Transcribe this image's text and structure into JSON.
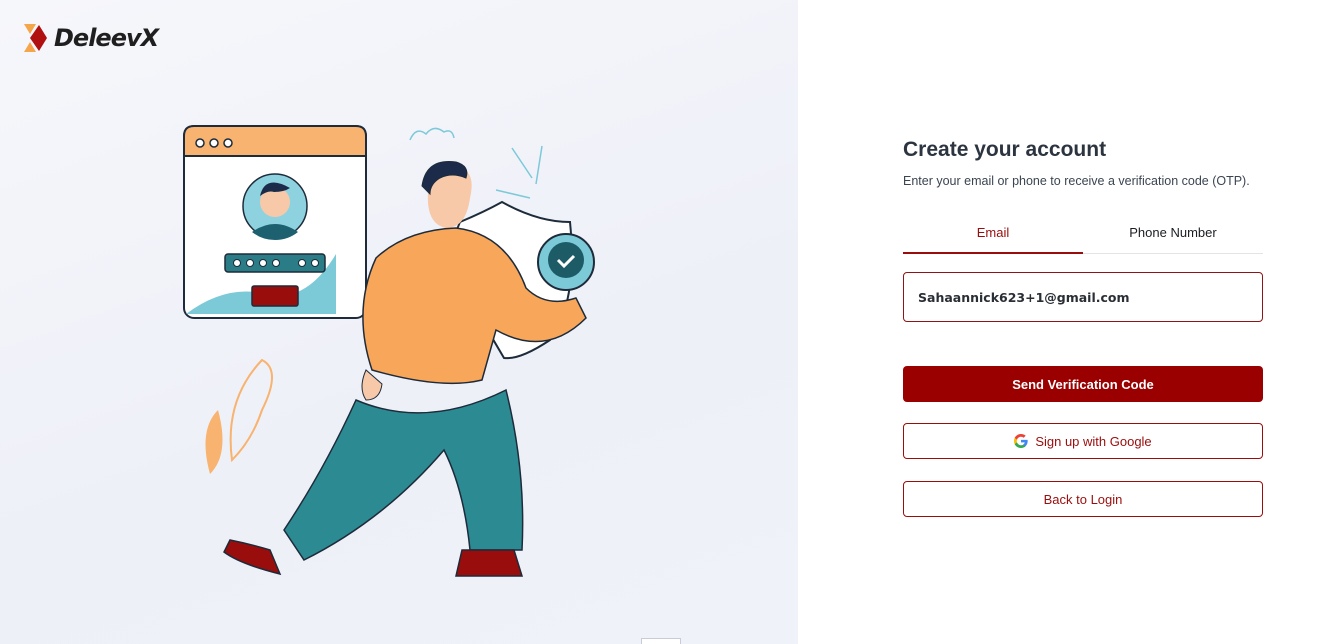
{
  "brand": {
    "name": "DeleevX"
  },
  "form": {
    "title": "Create your account",
    "subtitle": "Enter your email or phone to receive a verification code (OTP).",
    "tabs": [
      {
        "label": "Email",
        "active": true
      },
      {
        "label": "Phone Number",
        "active": false
      }
    ],
    "email_value": "Sahaannick623+1@gmail.com",
    "send_label": "Send Verification Code",
    "google_label": "Sign up with Google",
    "back_label": "Back to Login"
  },
  "colors": {
    "accent": "#9a0000",
    "left_background": "#f0f2f9"
  },
  "icons": [
    "deleevx-logo-icon",
    "google-icon",
    "login-illustration"
  ]
}
